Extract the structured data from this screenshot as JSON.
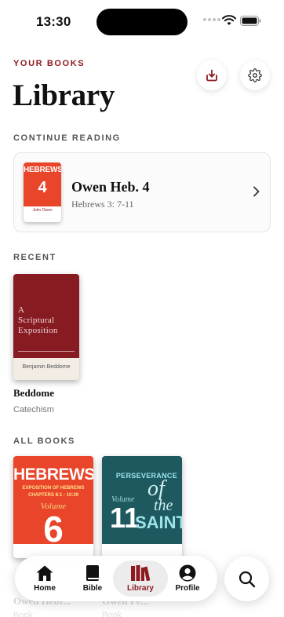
{
  "status": {
    "time": "13:30"
  },
  "header": {
    "eyebrow": "YOUR BOOKS",
    "title": "Library"
  },
  "continue_reading": {
    "label": "CONTINUE READING",
    "book": {
      "cover_title": "HEBREWS",
      "cover_number": "4",
      "cover_author": "John Owen",
      "title": "Owen Heb. 4",
      "subtitle": "Hebrews 3: 7-11"
    }
  },
  "recent": {
    "label": "RECENT",
    "books": [
      {
        "cover_line1": "A",
        "cover_line2": "Scriptural",
        "cover_line3": "Exposition",
        "cover_author": "Benjamin Beddome",
        "title": "Beddome",
        "category": "Catechism"
      }
    ]
  },
  "all_books": {
    "label": "ALL BOOKS",
    "books": [
      {
        "cover_title": "HEBREWS",
        "cover_sub1": "EXPOSITION OF HEBREWS",
        "cover_sub2": "CHAPTERS 8:1 - 10:39",
        "cover_vol": "Volume",
        "cover_number": "6",
        "title": "Owen Hebr...",
        "category": "Book"
      },
      {
        "cover_title": "PERSEVERANCE",
        "cover_of": "of",
        "cover_the": "the",
        "cover_vol": "Volume",
        "cover_number": "11",
        "cover_saints": "SAINTS",
        "title": "Owen Pe...",
        "category": "Book"
      }
    ]
  },
  "tabbar": {
    "tabs": [
      {
        "label": "Home",
        "icon": "home-icon"
      },
      {
        "label": "Bible",
        "icon": "bible-icon"
      },
      {
        "label": "Library",
        "icon": "library-icon",
        "active": true
      },
      {
        "label": "Profile",
        "icon": "profile-icon"
      }
    ]
  },
  "colors": {
    "accent": "#8c1a1f",
    "hebrews_red": "#e8452a",
    "perseverance_teal": "#1e5960"
  }
}
